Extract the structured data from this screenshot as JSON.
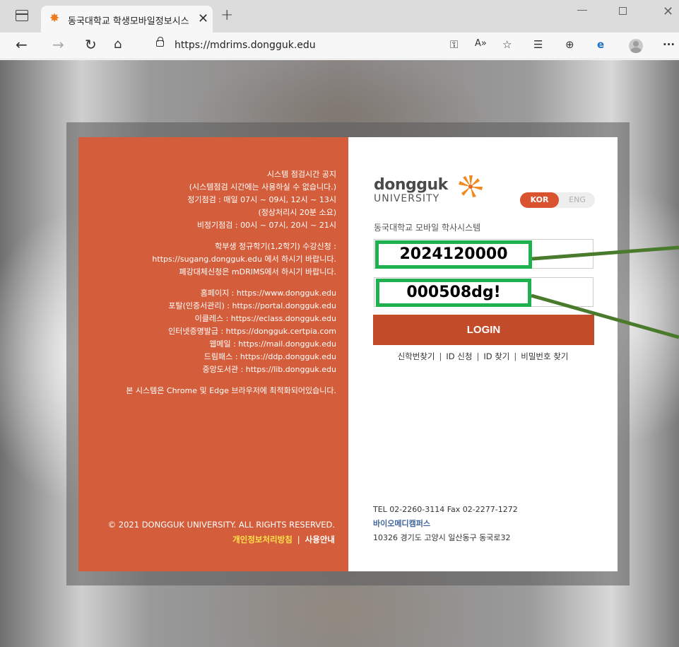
{
  "browser": {
    "tab_title": "동국대학교 학생모바일정보시스",
    "url": "https://mdrims.dongguk.edu"
  },
  "notice": {
    "lines": [
      "시스템 점검시간 공지",
      "(시스템점검 시간에는 사용하실 수 없습니다.)",
      "정기점검 : 매일 07시 ~ 09시, 12시 ~ 13시",
      "(정상처리시 20분 소요)",
      "비정기점검 : 00시 ~ 07시, 20시 ~ 21시",
      "",
      "학부생 정규학기(1,2학기) 수강신청 :",
      "https://sugang.dongguk.edu 에서 하시기 바랍니다.",
      "폐강대체신청은 mDRIMS에서 하시기 바랍니다.",
      "",
      "홈페이지 : https://www.dongguk.edu",
      "포탈(인증서관리) : https://portal.dongguk.edu",
      "이클레스 : https://eclass.dongguk.edu",
      "인터넷증명발급 : https://dongguk.certpia.com",
      "웹메일 : https://mail.dongguk.edu",
      "드림패스 : https://ddp.dongguk.edu",
      "중앙도서관 : https://lib.dongguk.edu",
      "",
      "본 시스템은 Chrome 및 Edge 브라우저에 최적화되어있습니다."
    ]
  },
  "left_footer": {
    "copyright": "© 2021 DONGGUK UNIVERSITY. ALL RIGHTS RESERVED.",
    "privacy": "개인정보처리방침",
    "separator": "|",
    "guide": "사용안내"
  },
  "logo": {
    "word": "dongguk",
    "sub": "UNIVERSITY"
  },
  "lang": {
    "kor": "KOR",
    "eng": "ENG"
  },
  "login": {
    "subtitle": "동국대학교 모바일 학사시스템",
    "id_value": "2024120000",
    "pw_value": "000508dg!",
    "button": "LOGIN",
    "links": [
      "신학번찾기",
      "ID 신청",
      "ID 찾기",
      "비밀번호 찾기"
    ],
    "link_sep": "|"
  },
  "contact": {
    "tel": "TEL 02-2260-3114 Fax 02-2277-1272",
    "campus": "바이오메디캠퍼스",
    "address": "10326 경기도 고양시 일산동구 동국로32"
  },
  "colors": {
    "left_panel": "#d45e3b",
    "login_button": "#c24b2a",
    "highlight": "#1fb050",
    "arrow": "#4a7a2c"
  }
}
